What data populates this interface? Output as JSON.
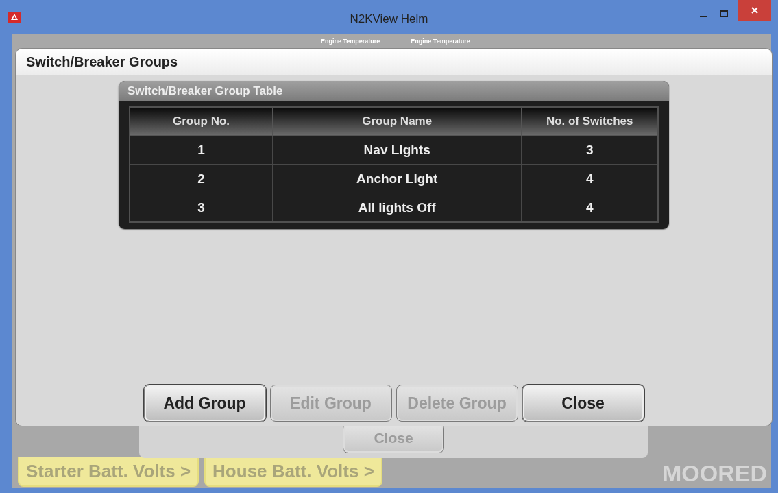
{
  "window": {
    "title": "N2KView Helm"
  },
  "background": {
    "gauge_labels": [
      "Engine Temperature",
      "Engine Temperature"
    ],
    "back_panel": {
      "button": {
        "label": "Close",
        "disabled": true
      }
    },
    "battery_buttons": [
      "Starter Batt. Volts >",
      "House Batt. Volts >"
    ],
    "status": "MOORED"
  },
  "dialog": {
    "title": "Switch/Breaker Groups",
    "table": {
      "title": "Switch/Breaker Group Table",
      "columns": [
        "Group No.",
        "Group Name",
        "No. of Switches"
      ],
      "rows": [
        [
          "1",
          "Nav Lights",
          "3"
        ],
        [
          "2",
          "Anchor Light",
          "4"
        ],
        [
          "3",
          "All lights Off",
          "4"
        ]
      ]
    },
    "buttons": [
      {
        "label": "Add Group",
        "disabled": false
      },
      {
        "label": "Edit Group",
        "disabled": true
      },
      {
        "label": "Delete Group",
        "disabled": true
      },
      {
        "label": "Close",
        "disabled": false
      }
    ]
  }
}
